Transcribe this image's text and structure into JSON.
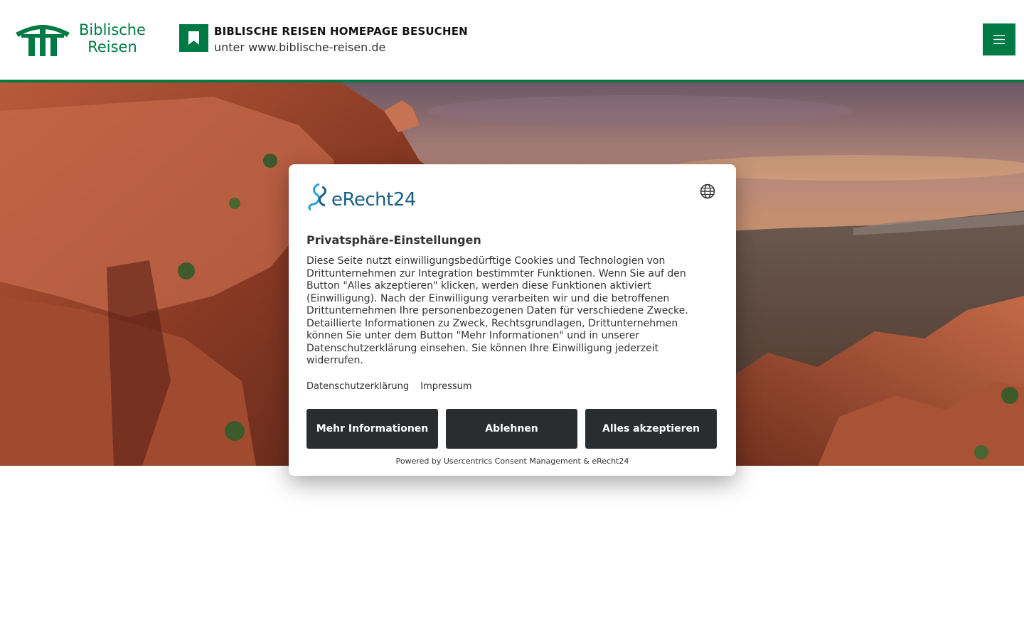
{
  "header": {
    "logo_line1": "Biblische",
    "logo_line2": "Reisen",
    "promo_title": "BIBLISCHE REISEN HOMEPAGE BESUCHEN",
    "promo_subtitle": "unter www.biblische-reisen.de",
    "menu_icon": "hamburger-icon",
    "bookmark_icon": "bookmark-icon"
  },
  "colors": {
    "brand_green": "#007a45",
    "button_dark": "#2a2d30",
    "erecht_blue": "#1b5f86",
    "erecht_light": "#2aa0d8"
  },
  "consent": {
    "brand": "eRecht24",
    "title": "Privatsphäre-Einstellungen",
    "body": "Diese Seite nutzt einwilligungsbedürftige Cookies und Technologien von Drittunternehmen zur Integration bestimmter Funktionen. Wenn Sie auf den Button \"Alles akzeptieren\" klicken, werden diese Funktionen aktiviert (Einwilligung). Nach der Einwilligung verarbeiten wir und die betroffenen Drittunternehmen Ihre personenbezogenen Daten für verschiedene Zwecke. Detaillierte Informationen zu Zweck, Rechtsgrundlagen, Drittunternehmen können Sie unter dem Button \"Mehr Informationen\" und in unserer Datenschutzerklärung einsehen. Sie können Ihre Einwilligung jederzeit widerrufen.",
    "links": {
      "privacy": "Datenschutzerklärung",
      "imprint": "Impressum"
    },
    "buttons": {
      "more": "Mehr Informationen",
      "deny": "Ablehnen",
      "accept": "Alles akzeptieren"
    },
    "powered_by": "Powered by Usercentrics Consent Management & eRecht24",
    "language_icon": "globe-icon"
  }
}
